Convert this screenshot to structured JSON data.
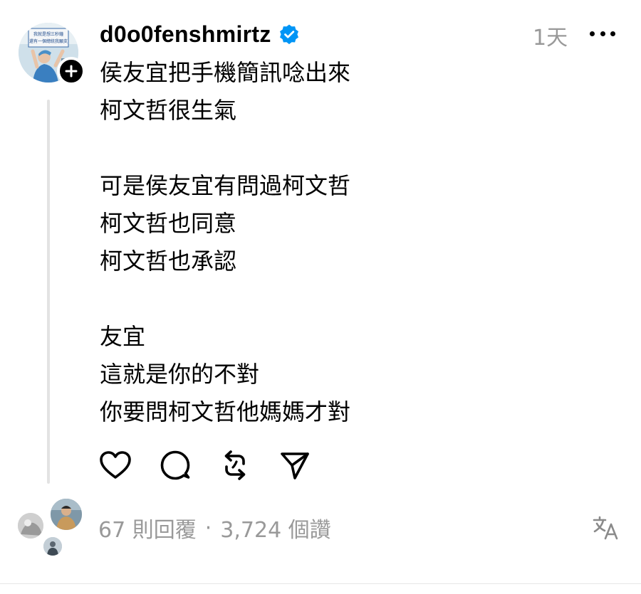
{
  "post": {
    "username": "d0o0fenshmirtz",
    "verified_icon": "verified-badge-icon",
    "timestamp": "1天",
    "body_lines": [
      "侯友宜把手機簡訊唸出來",
      "柯文哲很生氣",
      "",
      "可是侯友宜有問過柯文哲",
      "柯文哲也同意",
      "柯文哲也承認",
      "",
      "友宜",
      "這就是你的不對",
      "你要問柯文哲他媽媽才對"
    ],
    "avatar_sign_text": [
      "我就是想三秒鐘",
      "還有一個總統我願支"
    ],
    "actions": [
      "heart-icon",
      "comment-icon",
      "repost-icon",
      "share-icon"
    ],
    "footer": {
      "replies": "67 則回覆",
      "separator": "·",
      "likes": "3,724 個讚",
      "translate_icon": "translate-icon"
    }
  },
  "colors": {
    "text": "#000000",
    "muted": "#999999",
    "verified": "#0095f6",
    "thread_line": "#e3e3e3"
  }
}
